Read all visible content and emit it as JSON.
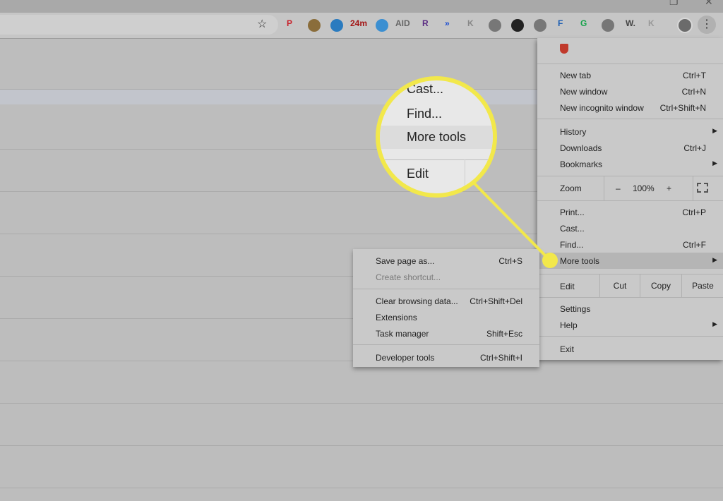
{
  "window": {
    "maximize_glyph": "❐",
    "close_glyph": "✕"
  },
  "toolbar": {
    "bookmark_glyph": "☆",
    "menu_glyph": "⋮",
    "extensions": [
      {
        "name": "pinterest-icon",
        "color": "#c8232c",
        "text": "P"
      },
      {
        "name": "eyedropper-icon",
        "color": "#8a6d3b",
        "text": ""
      },
      {
        "name": "shield-check-icon",
        "color": "#2a7bbf",
        "text": ""
      },
      {
        "name": "timer-icon",
        "color": "#a31515",
        "text": "24m"
      },
      {
        "name": "speed-icon",
        "color": "#3b8fd1",
        "text": ""
      },
      {
        "name": "aid-icon",
        "color": "#666666",
        "text": "AID"
      },
      {
        "name": "r-icon",
        "color": "#5b2c83",
        "text": "R"
      },
      {
        "name": "arrows-icon",
        "color": "#1f4fd1",
        "text": "»"
      },
      {
        "name": "k-icon",
        "color": "#888888",
        "text": "K"
      },
      {
        "name": "acorn-icon",
        "color": "#777777",
        "text": ""
      },
      {
        "name": "owl-icon",
        "color": "#222222",
        "text": ""
      },
      {
        "name": "briefcase-icon",
        "color": "#777777",
        "text": ""
      },
      {
        "name": "f-icon",
        "color": "#1d5fb3",
        "text": "F"
      },
      {
        "name": "grammarly-icon",
        "color": "#15a34a",
        "text": "G"
      },
      {
        "name": "feather-icon",
        "color": "#777777",
        "text": ""
      },
      {
        "name": "w-icon",
        "color": "#444444",
        "text": "W."
      },
      {
        "name": "k2-icon",
        "color": "#999999",
        "text": "K"
      }
    ]
  },
  "menu": {
    "new_tab": {
      "label": "New tab",
      "shortcut": "Ctrl+T"
    },
    "new_window": {
      "label": "New window",
      "shortcut": "Ctrl+N"
    },
    "new_incognito": {
      "label": "New incognito window",
      "shortcut": "Ctrl+Shift+N"
    },
    "history": {
      "label": "History",
      "arrow": "▶"
    },
    "downloads": {
      "label": "Downloads",
      "shortcut": "Ctrl+J"
    },
    "bookmarks": {
      "label": "Bookmarks",
      "arrow": "▶"
    },
    "zoom": {
      "label": "Zoom",
      "minus": "–",
      "value": "100%",
      "plus": "+"
    },
    "print": {
      "label": "Print...",
      "shortcut": "Ctrl+P"
    },
    "cast": {
      "label": "Cast..."
    },
    "find": {
      "label": "Find...",
      "shortcut": "Ctrl+F"
    },
    "more_tools": {
      "label": "More tools",
      "arrow": "▶"
    },
    "edit": {
      "label": "Edit",
      "cut": "Cut",
      "copy": "Copy",
      "paste": "Paste"
    },
    "settings": {
      "label": "Settings"
    },
    "help": {
      "label": "Help",
      "arrow": "▶"
    },
    "exit": {
      "label": "Exit"
    }
  },
  "submenu": {
    "save_page": {
      "label": "Save page as...",
      "shortcut": "Ctrl+S"
    },
    "create_shortcut": {
      "label": "Create shortcut..."
    },
    "clear_browsing": {
      "label": "Clear browsing data...",
      "shortcut": "Ctrl+Shift+Del"
    },
    "extensions": {
      "label": "Extensions"
    },
    "task_manager": {
      "label": "Task manager",
      "shortcut": "Shift+Esc"
    },
    "developer_tools": {
      "label": "Developer tools",
      "shortcut": "Ctrl+Shift+I"
    }
  },
  "magnifier": {
    "cast": "Cast...",
    "find": "Find...",
    "more_tools": "More tools",
    "edit": "Edit"
  }
}
